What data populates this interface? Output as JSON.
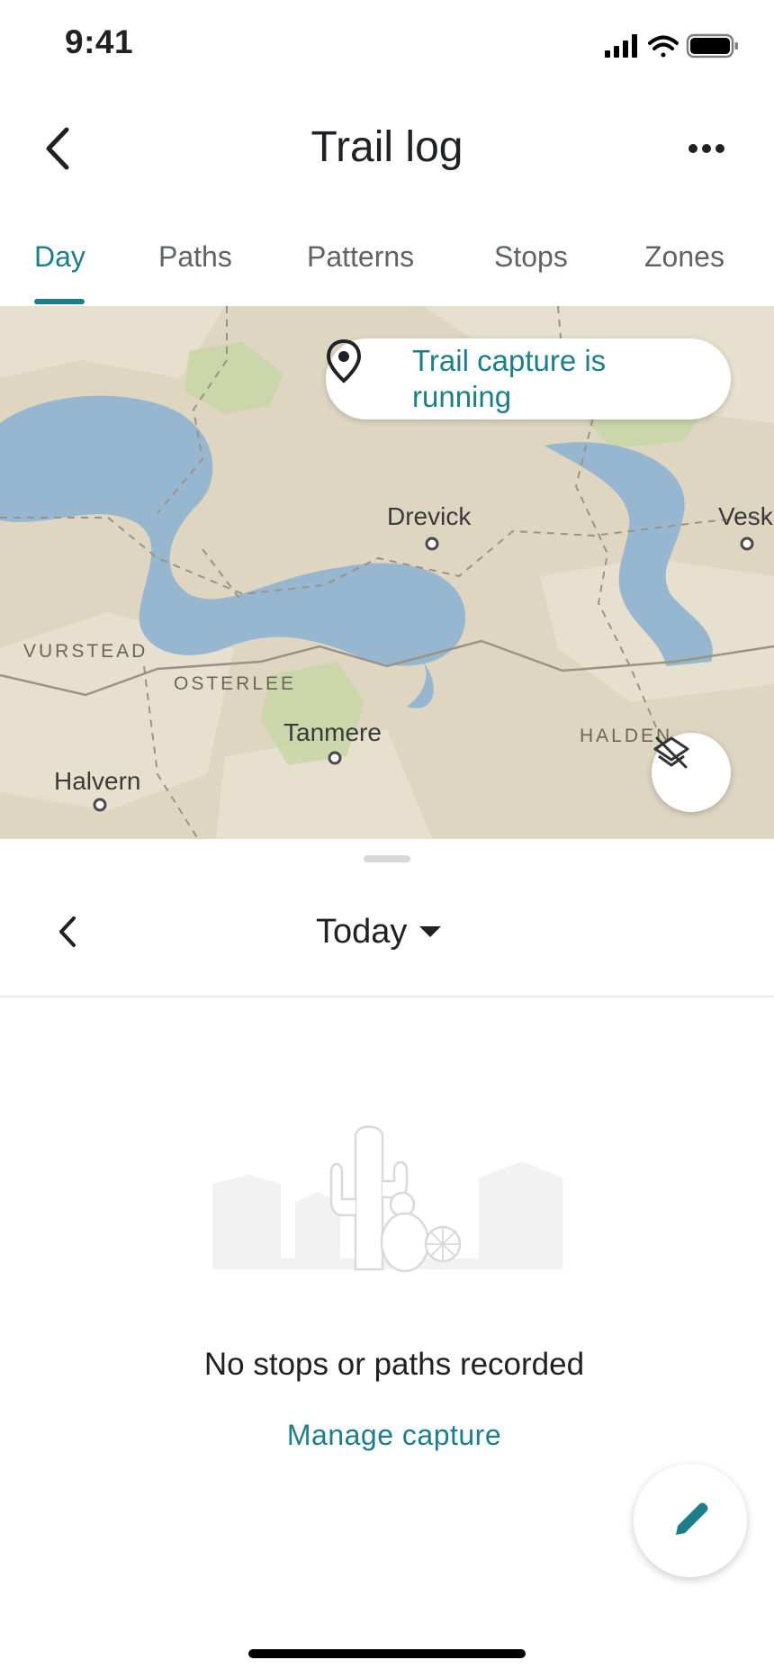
{
  "status_bar": {
    "time": "9:41"
  },
  "header": {
    "title": "Trail log"
  },
  "tabs": [
    {
      "label": "Day",
      "active": true
    },
    {
      "label": "Paths"
    },
    {
      "label": "Patterns"
    },
    {
      "label": "Stops"
    },
    {
      "label": "Zones"
    }
  ],
  "map": {
    "banner": "Trail capture is running",
    "places": [
      "Drevick",
      "Vesk",
      "Tanmere",
      "Halvern"
    ],
    "regions": [
      "VURSTEAD",
      "OSTERLEE",
      "HALDEN"
    ]
  },
  "date_nav": {
    "label": "Today"
  },
  "empty_state": {
    "message": "No stops or paths recorded",
    "action": "Manage capture"
  },
  "colors": {
    "accent": "#1a7f8a",
    "water": "#96b7cf",
    "land": "#dfd6c2",
    "park": "#c9d6a8"
  },
  "icons": [
    "back-icon",
    "more-icon",
    "location-pin-icon",
    "layers-icon",
    "chevron-left-icon",
    "dropdown-caret-icon",
    "edit-icon"
  ]
}
